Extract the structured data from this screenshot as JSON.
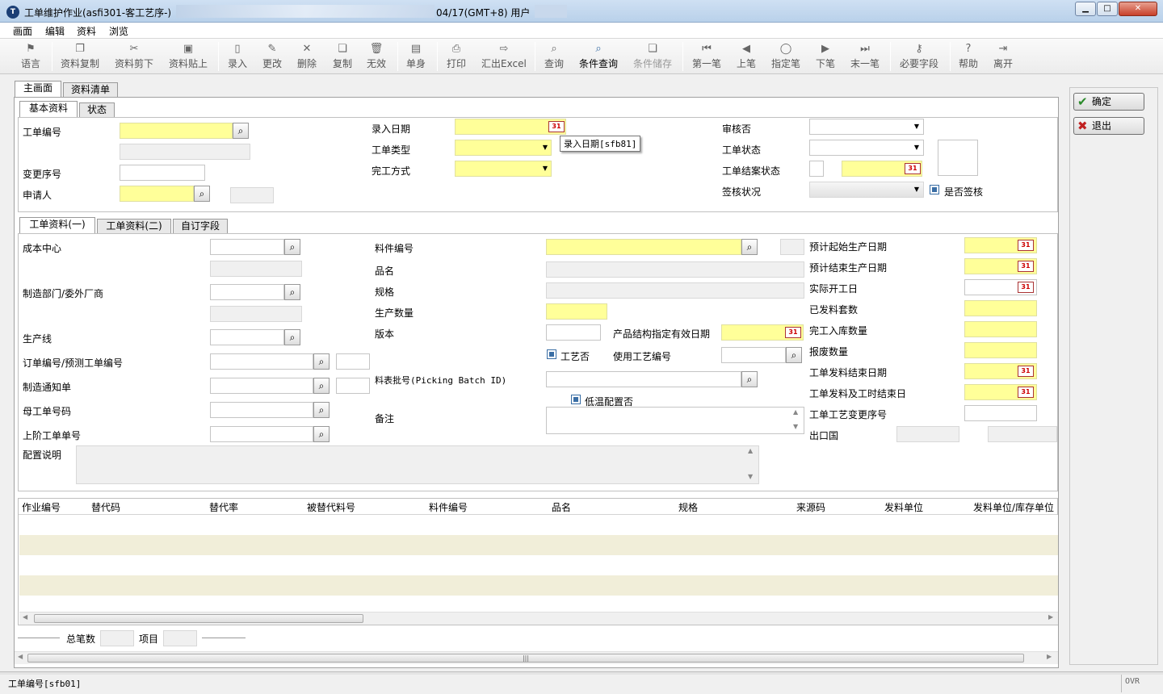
{
  "window": {
    "title": "工单维护作业(asfi301-客工艺序-)",
    "title_suffix": "04/17(GMT+8)  用户"
  },
  "menu": [
    "画面",
    "编辑",
    "资料",
    "浏览"
  ],
  "toolbar": [
    {
      "label": "语言",
      "icon": "flag-icon"
    },
    {
      "label": "资料复制",
      "icon": "copy-data-icon"
    },
    {
      "label": "资料剪下",
      "icon": "cut-icon"
    },
    {
      "label": "资料贴上",
      "icon": "paste-icon"
    },
    {
      "label": "录入",
      "icon": "new-doc-icon"
    },
    {
      "label": "更改",
      "icon": "pencil-icon"
    },
    {
      "label": "删除",
      "icon": "delete-icon"
    },
    {
      "label": "复制",
      "icon": "copy-icon"
    },
    {
      "label": "无效",
      "icon": "trash-icon"
    },
    {
      "label": "单身",
      "icon": "detail-icon"
    },
    {
      "label": "打印",
      "icon": "printer-icon"
    },
    {
      "label": "汇出Excel",
      "icon": "export-excel-icon"
    },
    {
      "label": "查询",
      "icon": "binoculars-icon"
    },
    {
      "label": "条件查询",
      "icon": "condition-query-icon"
    },
    {
      "label": "条件储存",
      "icon": "condition-save-icon"
    },
    {
      "label": "第一笔",
      "icon": "first-record-icon"
    },
    {
      "label": "上笔",
      "icon": "prev-record-icon"
    },
    {
      "label": "指定笔",
      "icon": "goto-record-icon"
    },
    {
      "label": "下笔",
      "icon": "next-record-icon"
    },
    {
      "label": "末一笔",
      "icon": "last-record-icon"
    },
    {
      "label": "必要字段",
      "icon": "key-icon"
    },
    {
      "label": "帮助",
      "icon": "help-icon"
    },
    {
      "label": "离开",
      "icon": "exit-door-icon"
    }
  ],
  "tabs_main": [
    "主画面",
    "资料清单"
  ],
  "tabs_basic": [
    "基本资料",
    "状态"
  ],
  "tabs_detail": [
    "工单资料(一)",
    "工单资料(二)",
    "自订字段"
  ],
  "basic": {
    "wo_no": "工单编号",
    "change_seq": "变更序号",
    "applicant": "申请人",
    "entry_date": "录入日期",
    "wo_type": "工单类型",
    "finish_method": "完工方式",
    "approve": "审核否",
    "wo_status": "工单状态",
    "close_status": "工单结案状态",
    "sign_status": "签核状况",
    "is_sign": "是否签核",
    "tooltip": "录入日期[sfb81]"
  },
  "detail": {
    "cost_center": "成本中心",
    "dept": "制造部门/委外厂商",
    "line": "生产线",
    "order_no": "订单编号/预测工单编号",
    "mfg_notice": "制造通知单",
    "parent_wo": "母工单号码",
    "upper_wo": "上阶工单单号",
    "config_desc": "配置说明",
    "item_no": "料件编号",
    "item_name": "品名",
    "spec": "规格",
    "qty": "生产数量",
    "version": "版本",
    "bom_date": "产品结构指定有效日期",
    "process": "工艺否",
    "use_process": "使用工艺编号",
    "picking_batch": "料表批号(Picking Batch ID)",
    "low_temp": "低温配置否",
    "note": "备注",
    "plan_start": "预计起始生产日期",
    "plan_end": "预计结束生产日期",
    "actual_start": "实际开工日",
    "issued_sets": "已发料套数",
    "completed_qty": "完工入库数量",
    "scrap_qty": "报废数量",
    "issue_end": "工单发料结束日期",
    "issue_time_end": "工单发料及工时结束日",
    "process_change": "工单工艺变更序号",
    "export_country": "出口国"
  },
  "grid": {
    "columns": [
      "作业编号",
      "替代码",
      "替代率",
      "被替代料号",
      "料件编号",
      "品名",
      "规格",
      "来源码",
      "发料单位",
      "发料单位/库存单位"
    ]
  },
  "footer": {
    "total": "总笔数",
    "item": "项目"
  },
  "actions": {
    "ok": "确定",
    "exit": "退出"
  },
  "status": {
    "left": "工单编号[sfb01]",
    "right": "OVR"
  }
}
